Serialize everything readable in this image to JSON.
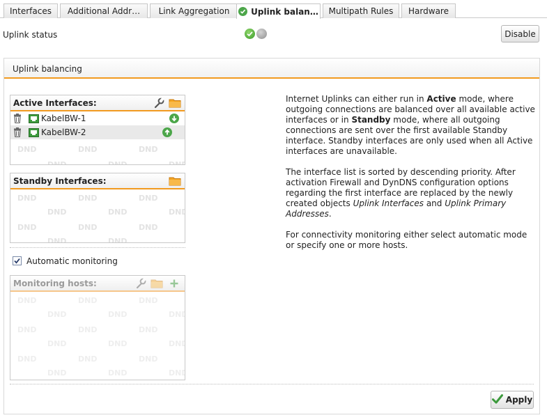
{
  "tabs": [
    {
      "label": "Interfaces",
      "active": false
    },
    {
      "label": "Additional Addr…",
      "active": false
    },
    {
      "label": "Link Aggregation",
      "active": false
    },
    {
      "label": "Uplink balan…",
      "active": true,
      "icon": "check-circle-icon"
    },
    {
      "label": "Multipath Rules",
      "active": false
    },
    {
      "label": "Hardware",
      "active": false
    }
  ],
  "status": {
    "label": "Uplink status",
    "leds": [
      "green",
      "grey"
    ],
    "disable_label": "Disable"
  },
  "panel": {
    "title": "Uplink balancing"
  },
  "active_box": {
    "title": "Active Interfaces:",
    "icons": [
      "wrench-icon",
      "folder-icon"
    ],
    "rows": [
      {
        "name": "KabelBW-1",
        "arrow": "down-arrow-icon",
        "selected": false
      },
      {
        "name": "KabelBW-2",
        "arrow": "up-arrow-icon",
        "selected": true
      }
    ]
  },
  "standby_box": {
    "title": "Standby Interfaces:",
    "icons": [
      "folder-icon"
    ]
  },
  "dnd_text": "DND",
  "monitoring": {
    "checkbox_label": "Automatic monitoring",
    "checked": true
  },
  "hosts_box": {
    "title": "Monitoring hosts:",
    "icons": [
      "wrench-icon",
      "folder-icon",
      "plus-icon"
    ]
  },
  "help": {
    "p1_a": "Internet Uplinks can either run in ",
    "p1_b": "Active",
    "p1_c": " mode, where outgoing connections are balanced over all available active interfaces or in ",
    "p1_d": "Standby",
    "p1_e": " mode, where all outgoing connections are sent over the first available Standby interface. Standby interfaces are only used when all Active interfaces are unavailable.",
    "p2_a": "The interface list is sorted by descending priority. After activation Firewall and DynDNS configuration options regarding the first interface are replaced by the newly created objects ",
    "p2_b": "Uplink Interfaces",
    "p2_c": " and ",
    "p2_d": "Uplink Primary Addresses",
    "p2_e": ".",
    "p3": "For connectivity monitoring either select automatic mode or specify one or more hosts."
  },
  "apply_label": "Apply",
  "colors": {
    "accent": "#f29a1f",
    "ok_green": "#4ca64a"
  }
}
